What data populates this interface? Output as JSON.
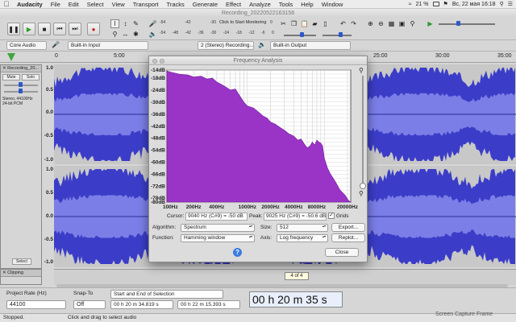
{
  "menubar": {
    "app": "Audacity",
    "items": [
      "File",
      "Edit",
      "Select",
      "View",
      "Transport",
      "Tracks",
      "Generate",
      "Effect",
      "Analyze",
      "Tools",
      "Help",
      "Window"
    ],
    "battery": "21 %",
    "datetime": "Вс, 22 мая  16:18"
  },
  "window": {
    "title": "Recording_20220522163158"
  },
  "toolbar": {
    "monitor_label": "Click to Start Monitoring",
    "meter_ticks_rec": [
      "-54",
      "-48",
      "-42",
      "-36",
      "-30",
      "-24",
      "-18",
      "-12",
      "-6",
      "0"
    ],
    "meter_ticks_play": [
      "-54",
      "-48",
      "-42",
      "-36",
      "-30",
      "-24",
      "-18",
      "-12",
      "-6",
      "0"
    ]
  },
  "devices": {
    "host": "Core Audio",
    "input": "Built-in Input",
    "channels": "2 (Stereo) Recording...",
    "output": "Built-in Output"
  },
  "timeline": {
    "labels": [
      "0",
      "5:00",
      "25:00",
      "30:00",
      "35:00"
    ]
  },
  "track": {
    "name": "Recording_20...",
    "mute": "Mute",
    "solo": "Solo",
    "info": [
      "Stereo, 44100Hz",
      "24-bit PCM"
    ],
    "select": "Select",
    "scale_ch1": [
      "1.0",
      "0.5",
      "0.0",
      "-0.5",
      "-1.0"
    ],
    "scale_ch2": [
      "1.0",
      "0.5",
      "0.0",
      "-0.5",
      "-1.0"
    ]
  },
  "label_track": {
    "name": "Clipping",
    "label": "4 of 4"
  },
  "bottom": {
    "project_rate_label": "Project Rate (Hz)",
    "project_rate": "44100",
    "snap_label": "Snap-To",
    "snap_value": "Off",
    "selection_mode": "Start and End of Selection",
    "sel_start": "00 h 20 m 34.819 s",
    "sel_end": "00 h 22 m 15.393 s",
    "time": "00 h 20 m 35 s"
  },
  "status": {
    "left": "Stopped.",
    "hint": "Click and drag to select audio",
    "tooltip": "Screen Capture Frame"
  },
  "dialog": {
    "title": "Frequency Analysis",
    "cursor_label": "Cursor:",
    "cursor_value": "9040 Hz (C#9) = -50 dB",
    "peak_label": "Peak:",
    "peak_value": "9025 Hz (C#9) = -50.6 dB",
    "grids_label": "Grids",
    "grids_checked": true,
    "algorithm_label": "Algorithm:",
    "algorithm": "Spectrum",
    "size_label": "Size:",
    "size": "512",
    "function_label": "Function:",
    "function": "Hamming window",
    "axis_label": "Axis:",
    "axis": "Log frequency",
    "export": "Export...",
    "replot": "Replot...",
    "close": "Close",
    "help_icon": "help-icon"
  },
  "chart_data": {
    "type": "area",
    "title": "",
    "xlabel": "",
    "ylabel": "",
    "x_scale": "log",
    "xlim": [
      90,
      22050
    ],
    "ylim": [
      -80,
      -14
    ],
    "x_ticks": [
      "100Hz",
      "200Hz",
      "400Hz",
      "1000Hz",
      "2000Hz",
      "4000Hz",
      "8000Hz",
      "20000Hz"
    ],
    "y_ticks": [
      "-14dB",
      "-18dB",
      "-24dB",
      "-30dB",
      "-36dB",
      "-42dB",
      "-48dB",
      "-54dB",
      "-60dB",
      "-66dB",
      "-72dB",
      "-78dB",
      "-80dB"
    ],
    "grid": true,
    "color": "#9a34c7",
    "series": [
      {
        "x": [
          90,
          100,
          130,
          170,
          200,
          250,
          300,
          350,
          400,
          450,
          500,
          600,
          700,
          800,
          900,
          1000,
          1200,
          1400,
          1600,
          1800,
          2000,
          2300,
          2600,
          3000,
          3500,
          4000,
          4500,
          5000,
          5500,
          6000,
          6500,
          7000,
          7500,
          8000,
          8500,
          9000,
          9500,
          10000,
          11000,
          12000,
          13000,
          14000,
          15000,
          16000,
          17000,
          18000,
          19000,
          20000,
          21000,
          22050
        ],
        "y": [
          -14.5,
          -15,
          -16,
          -16.5,
          -17.5,
          -17,
          -18.5,
          -18,
          -20,
          -21,
          -22,
          -24,
          -23.5,
          -27,
          -30,
          -32,
          -33,
          -35,
          -37,
          -38,
          -40,
          -41,
          -42.5,
          -44,
          -46,
          -47,
          -49,
          -48.5,
          -51,
          -53,
          -52,
          -50,
          -51.5,
          -49,
          -50,
          -50.6,
          -52,
          -58,
          -63,
          -66,
          -68,
          -70,
          -72,
          -74,
          -75,
          -76,
          -77,
          -78.5,
          -79.5,
          -80
        ]
      }
    ]
  }
}
